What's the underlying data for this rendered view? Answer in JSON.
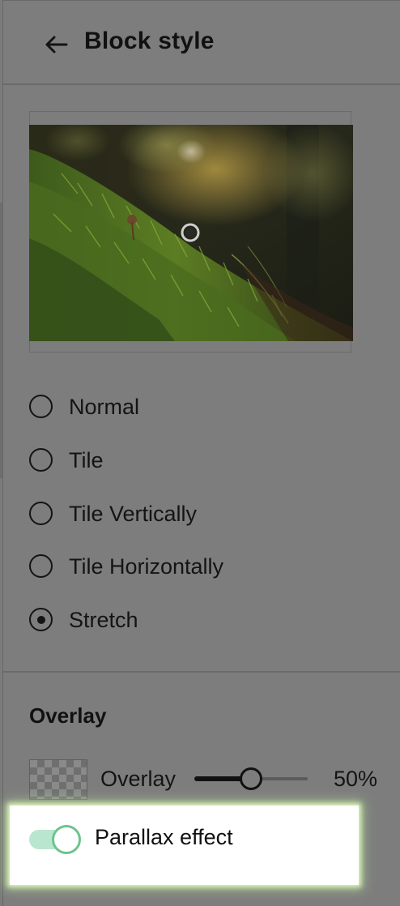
{
  "header": {
    "title": "Block style",
    "back_icon": "arrow-left-icon"
  },
  "image": {
    "focal_point_icon": "focal-point-icon"
  },
  "background_mode": {
    "options": [
      {
        "label": "Normal",
        "selected": false
      },
      {
        "label": "Tile",
        "selected": false
      },
      {
        "label": "Tile Vertically",
        "selected": false
      },
      {
        "label": "Tile Horizontally",
        "selected": false
      },
      {
        "label": "Stretch",
        "selected": true
      }
    ]
  },
  "overlay": {
    "section_title": "Overlay",
    "label": "Overlay",
    "value_text": "50%",
    "value": 50
  },
  "parallax": {
    "label": "Parallax effect",
    "enabled": true
  },
  "colors": {
    "accent": "#6cc48f",
    "accent_track": "#b9e6cf",
    "highlight": "#ffffff",
    "dim_background": "#7d7d7d"
  }
}
